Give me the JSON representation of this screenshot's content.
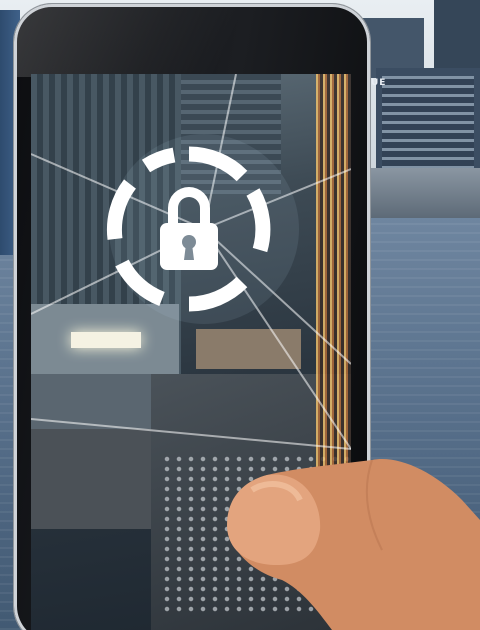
{
  "scene": {
    "description_icons": [
      "lock-icon"
    ],
    "colors": {
      "lock": "#ffffff",
      "phone_body": "#111316",
      "water": "#5d7590",
      "skin": "#d8956a"
    }
  },
  "background": {
    "sign_text": "UE"
  }
}
